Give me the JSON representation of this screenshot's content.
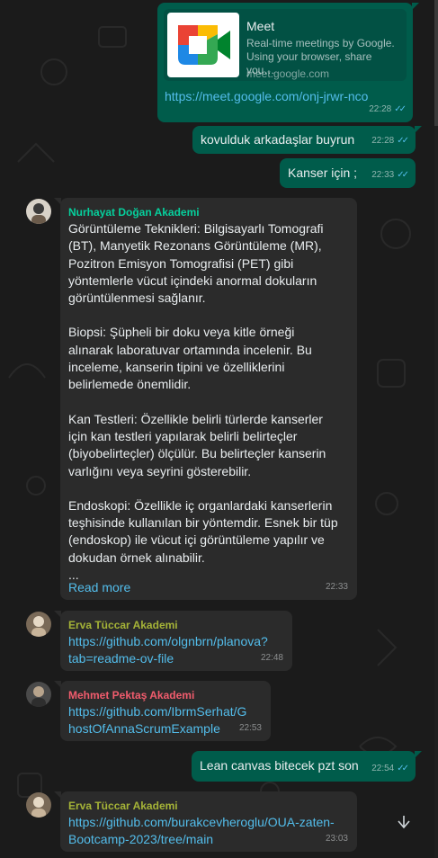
{
  "theme": {
    "outgoing_bubble": "#005c4b",
    "incoming_bubble": "#2b2b2b",
    "link_color": "#53bdeb",
    "read_ticks_color": "#53bdeb",
    "sender_colors": {
      "nurhayat": "#06cf9c",
      "erva": "#a5b337",
      "mehmet": "#f15c6d"
    }
  },
  "messages": [
    {
      "direction": "out",
      "preview": {
        "title": "Meet",
        "description": "Real-time meetings by Google. Using your browser, share you…",
        "host": "meet.google.com",
        "icon": "google-meet-logo"
      },
      "link": "https://meet.google.com/onj-jrwr-nco",
      "time": "22:28",
      "status": "read"
    },
    {
      "direction": "out",
      "text": "kovulduk arkadaşlar buyrun",
      "time": "22:28",
      "status": "read"
    },
    {
      "direction": "out",
      "text": "Kanser için ;",
      "time": "22:33",
      "status": "read"
    },
    {
      "direction": "in",
      "sender": "Nurhayat Doğan Akademi",
      "paragraphs": [
        "Görüntüleme Teknikleri: Bilgisayarlı Tomografi (BT), Manyetik Rezonans Görüntüleme (MR), Pozitron Emisyon Tomografisi (PET) gibi yöntemlerle vücut içindeki anormal dokuların görüntülenmesi sağlanır.",
        "Biopsi: Şüpheli bir doku veya kitle örneği alınarak laboratuvar ortamında incelenir. Bu inceleme, kanserin tipini ve özelliklerini belirlemede önemlidir.",
        "Kan Testleri: Özellikle belirli türlerde kanserler için kan testleri yapılarak belirli belirteçler (biyobelirteçler) ölçülür. Bu belirteçler kanserin varlığını veya seyrini gösterebilir.",
        "Endoskopi: Özellikle iç organlardaki kanserlerin teşhisinde kullanılan bir yöntemdir. Esnek bir tüp (endoskop) ile vücut içi görüntüleme yapılır ve dokudan örnek alınabilir."
      ],
      "ellipsis": "...",
      "read_more": "Read more",
      "time": "22:33"
    },
    {
      "direction": "in",
      "sender": "Erva Tüccar Akademi",
      "link": "https://github.com/olgnbrn/planova?tab=readme-ov-file",
      "time": "22:48"
    },
    {
      "direction": "in",
      "sender": "Mehmet Pektaş Akademi",
      "link": "https://github.com/IbrmSerhat/GhostOfAnnaScrumExample",
      "time": "22:53"
    },
    {
      "direction": "out",
      "text": "Lean canvas bitecek pzt son",
      "time": "22:54",
      "status": "read"
    },
    {
      "direction": "in",
      "sender": "Erva Tüccar Akademi",
      "link": "https://github.com/burakcevheroglu/OUA-zaten-Bootcamp-2023/tree/main",
      "time": "23:03"
    }
  ],
  "controls": {
    "scroll_down_icon": "chevron-down-icon"
  }
}
